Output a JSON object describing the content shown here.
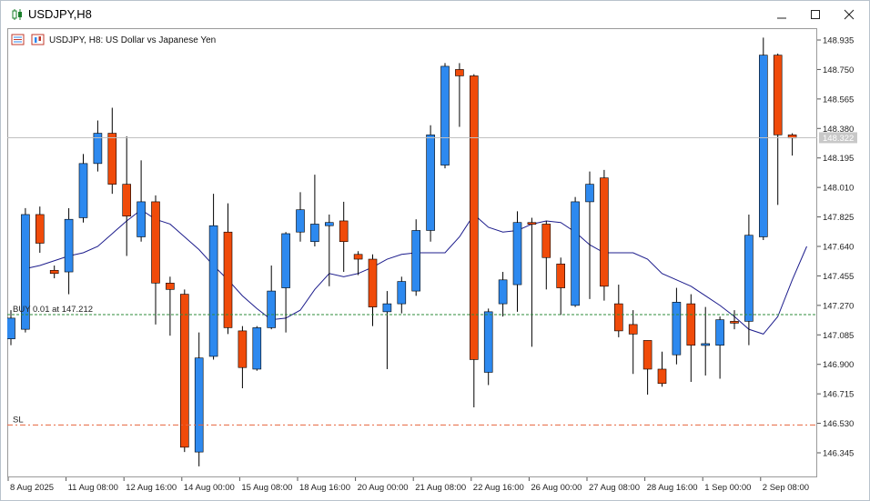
{
  "window": {
    "title": "USDJPY,H8",
    "minimize_icon": "minimize-icon",
    "maximize_icon": "maximize-icon",
    "close_icon": "close-icon"
  },
  "chart_header": {
    "text": "USDJPY, H8:  US Dollar vs Japanese Yen",
    "icons": [
      "trade-panel-icon",
      "chart-indicator-icon"
    ]
  },
  "trade_lines": {
    "buy_label": "BUY 0.01 at 147.212",
    "buy_price": 147.212,
    "sl_label": "SL",
    "sl_price": 146.52,
    "current_price": 148.322,
    "current_price_label": "148.322"
  },
  "colors": {
    "bull": "#2d89ef",
    "bear": "#f04b0a",
    "ma_line": "#1c1c8c",
    "buy_line": "#2e8b3a",
    "sl_line": "#e8643c",
    "price_line": "#c0c0c0"
  },
  "chart_data": {
    "type": "candlestick",
    "symbol": "USDJPY",
    "timeframe": "H8",
    "y_ticks": [
      "148.935",
      "148.750",
      "148.565",
      "148.380",
      "148.195",
      "148.010",
      "147.825",
      "147.640",
      "147.455",
      "147.270",
      "147.085",
      "146.900",
      "146.715",
      "146.530",
      "146.345"
    ],
    "ylim": [
      146.18,
      149.03
    ],
    "x_labels": [
      "8 Aug 2025",
      "11 Aug 08:00",
      "12 Aug 16:00",
      "14 Aug 00:00",
      "15 Aug 08:00",
      "18 Aug 16:00",
      "20 Aug 00:00",
      "21 Aug 08:00",
      "22 Aug 16:00",
      "26 Aug 00:00",
      "27 Aug 08:00",
      "28 Aug 16:00",
      "1 Sep 00:00",
      "2 Sep 08:00"
    ],
    "candles": [
      [
        147.06,
        147.19,
        147.02,
        147.24
      ],
      [
        147.12,
        147.84,
        147.1,
        147.88
      ],
      [
        147.84,
        147.66,
        147.6,
        147.89
      ],
      [
        147.49,
        147.47,
        147.44,
        147.52
      ],
      [
        147.48,
        147.81,
        147.34,
        147.88
      ],
      [
        147.82,
        148.16,
        147.79,
        148.22
      ],
      [
        148.16,
        148.35,
        148.11,
        148.43
      ],
      [
        148.35,
        148.03,
        147.97,
        148.51
      ],
      [
        148.03,
        147.83,
        147.58,
        148.33
      ],
      [
        147.7,
        147.92,
        147.67,
        148.18
      ],
      [
        147.92,
        147.41,
        147.15,
        147.96
      ],
      [
        147.41,
        147.37,
        147.08,
        147.45
      ],
      [
        147.34,
        146.38,
        146.35,
        147.37
      ],
      [
        146.35,
        146.94,
        146.26,
        147.1
      ],
      [
        146.95,
        147.77,
        146.93,
        147.97
      ],
      [
        147.73,
        147.13,
        147.09,
        147.91
      ],
      [
        147.11,
        146.88,
        146.75,
        147.14
      ],
      [
        146.87,
        147.13,
        146.86,
        147.14
      ],
      [
        147.13,
        147.36,
        147.12,
        147.52
      ],
      [
        147.38,
        147.72,
        147.1,
        147.73
      ],
      [
        147.73,
        147.87,
        147.67,
        147.98
      ],
      [
        147.67,
        147.78,
        147.64,
        148.09
      ],
      [
        147.77,
        147.79,
        147.39,
        147.84
      ],
      [
        147.8,
        147.67,
        147.48,
        147.92
      ],
      [
        147.59,
        147.56,
        147.46,
        147.61
      ],
      [
        147.56,
        147.26,
        147.14,
        147.59
      ],
      [
        147.23,
        147.28,
        146.87,
        147.36
      ],
      [
        147.28,
        147.42,
        147.22,
        147.45
      ],
      [
        147.36,
        147.74,
        147.33,
        147.81
      ],
      [
        147.74,
        148.34,
        147.67,
        148.4
      ],
      [
        148.15,
        148.77,
        148.13,
        148.79
      ],
      [
        148.75,
        148.71,
        148.39,
        148.79
      ],
      [
        148.71,
        146.93,
        146.63,
        148.72
      ],
      [
        146.85,
        147.23,
        146.77,
        147.25
      ],
      [
        147.28,
        147.43,
        147.2,
        147.48
      ],
      [
        147.4,
        147.79,
        147.23,
        147.86
      ],
      [
        147.79,
        147.78,
        147.01,
        147.82
      ],
      [
        147.78,
        147.57,
        147.37,
        147.8
      ],
      [
        147.53,
        147.38,
        147.21,
        147.57
      ],
      [
        147.27,
        147.92,
        147.26,
        147.95
      ],
      [
        147.92,
        148.03,
        147.31,
        148.11
      ],
      [
        148.07,
        147.39,
        147.3,
        148.12
      ],
      [
        147.28,
        147.11,
        147.07,
        147.4
      ],
      [
        147.15,
        147.09,
        146.84,
        147.24
      ],
      [
        147.05,
        146.87,
        146.71,
        147.05
      ],
      [
        146.87,
        146.78,
        146.76,
        146.98
      ],
      [
        146.96,
        147.29,
        146.9,
        147.38
      ],
      [
        147.28,
        147.02,
        146.79,
        147.34
      ],
      [
        147.02,
        147.03,
        146.83,
        147.26
      ],
      [
        147.02,
        147.18,
        146.81,
        147.2
      ],
      [
        147.17,
        147.16,
        147.12,
        147.24
      ],
      [
        147.17,
        147.71,
        147.02,
        147.84
      ],
      [
        147.7,
        148.84,
        147.68,
        148.95
      ],
      [
        148.84,
        148.34,
        147.9,
        148.85
      ],
      [
        148.34,
        148.32,
        148.21,
        148.35
      ]
    ],
    "ma_series": [
      147.5,
      147.52,
      147.55,
      147.58,
      147.6,
      147.64,
      147.72,
      147.8,
      147.87,
      147.81,
      147.78,
      147.7,
      147.62,
      147.52,
      147.43,
      147.33,
      147.25,
      147.18,
      147.19,
      147.24,
      147.37,
      147.47,
      147.45,
      147.47,
      147.51,
      147.56,
      147.59,
      147.6,
      147.6,
      147.6,
      147.7,
      147.84,
      147.76,
      147.73,
      147.74,
      147.78,
      147.8,
      147.79,
      147.73,
      147.65,
      147.6,
      147.6,
      147.6,
      147.56,
      147.47,
      147.43,
      147.39,
      147.33,
      147.27,
      147.2,
      147.12,
      147.09,
      147.2,
      147.43,
      147.64
    ],
    "ma_start_index": 1
  }
}
